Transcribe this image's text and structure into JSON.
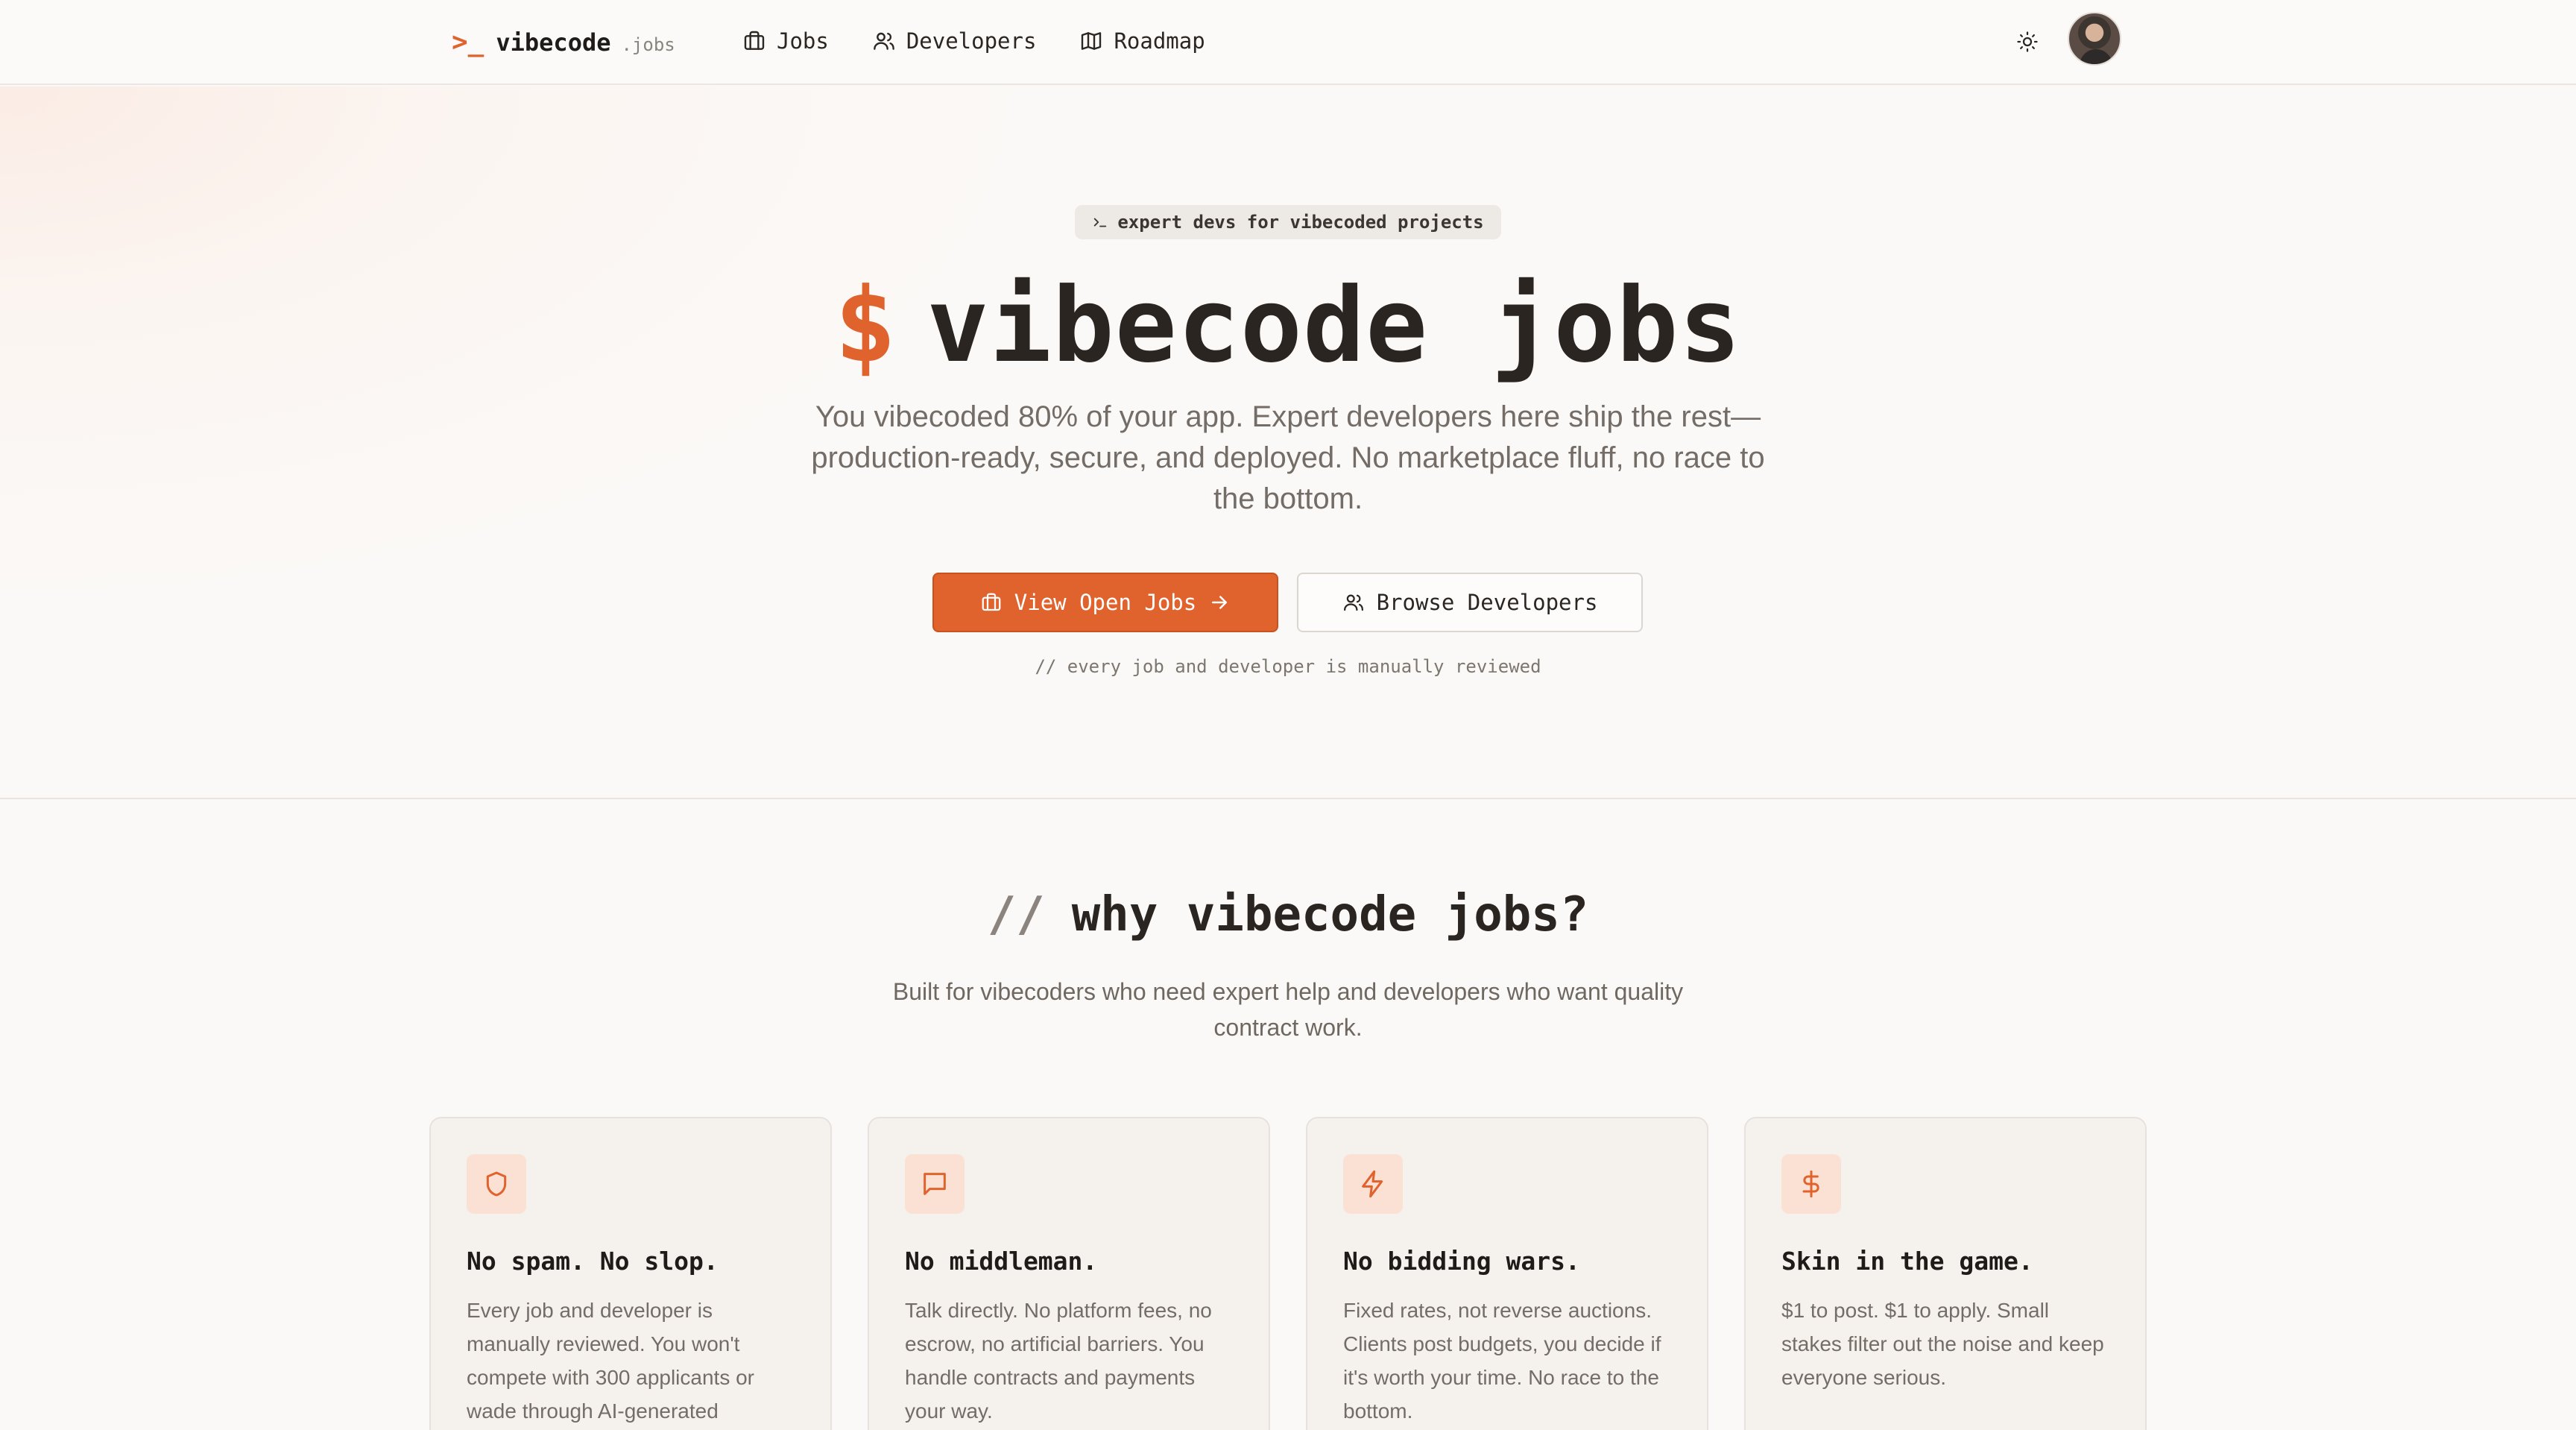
{
  "nav": {
    "brand_prompt": ">_",
    "brand_name": "vibecode",
    "brand_tld": ".jobs",
    "links": [
      {
        "label": "Jobs",
        "icon": "briefcase-icon"
      },
      {
        "label": "Developers",
        "icon": "users-icon"
      },
      {
        "label": "Roadmap",
        "icon": "map-icon"
      }
    ],
    "theme_icon": "sun-icon",
    "avatar": "user-avatar"
  },
  "hero": {
    "pill": "expert devs for vibecoded projects",
    "title_symbol": "$",
    "title": "vibecode jobs",
    "subtitle": "You vibecoded 80% of your app. Expert developers here ship the rest—production-ready, secure, and deployed. No marketplace fluff, no race to the bottom.",
    "primary_button": "View Open Jobs",
    "secondary_button": "Browse Developers",
    "note": "// every job and developer is manually reviewed"
  },
  "why": {
    "title_prefix": "//",
    "title": "why vibecode jobs?",
    "subtitle": "Built for vibecoders who need expert help and developers who want quality contract work.",
    "cards": [
      {
        "icon": "shield-icon",
        "title": "No spam. No slop.",
        "text": "Every job and developer is manually reviewed. You won't compete with 300 applicants or wade through AI-generated"
      },
      {
        "icon": "message-square-icon",
        "title": "No middleman.",
        "text": "Talk directly. No platform fees, no escrow, no artificial barriers. You handle contracts and payments your way."
      },
      {
        "icon": "zap-icon",
        "title": "No bidding wars.",
        "text": "Fixed rates, not reverse auctions. Clients post budgets, you decide if it's worth your time. No race to the bottom."
      },
      {
        "icon": "dollar-sign-icon",
        "title": "Skin in the game.",
        "text": "$1 to post. $1 to apply. Small stakes filter out the noise and keep everyone serious."
      }
    ]
  },
  "colors": {
    "accent": "#e0622d",
    "accent_soft": "#fbe1d4",
    "background": "#fbf9f7",
    "text": "#2b2622",
    "muted": "#746d67"
  }
}
